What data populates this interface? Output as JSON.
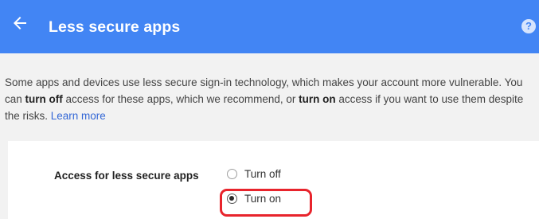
{
  "header": {
    "title": "Less secure apps",
    "help_glyph": "?"
  },
  "description": {
    "part1": "Some apps and devices use less secure sign-in technology, which makes your account more vulnerable. You can ",
    "turn_off": "turn off",
    "part2": " access for these apps, which we recommend, or ",
    "turn_on": "turn on",
    "part3": " access if you want to use them despite the risks. ",
    "learn_more": "Learn more"
  },
  "setting": {
    "label": "Access for less secure apps",
    "options": [
      {
        "label": "Turn off",
        "selected": false
      },
      {
        "label": "Turn on",
        "selected": true
      }
    ]
  },
  "colors": {
    "header_bg": "#4285f4",
    "link": "#3367d6",
    "page_bg": "#f2f2f2",
    "highlight": "#e8242c"
  },
  "icons": {
    "back": "arrow-left",
    "help": "question-circle"
  }
}
